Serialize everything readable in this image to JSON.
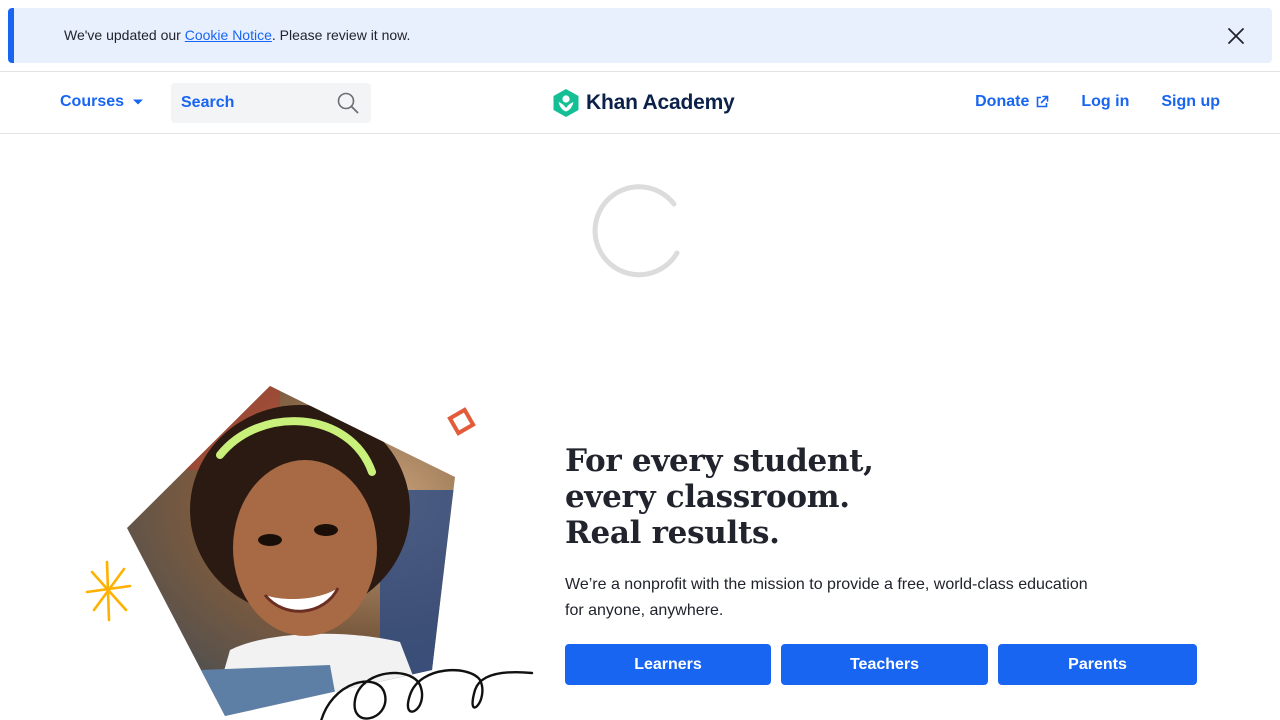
{
  "cookie_banner": {
    "prefix": "We've updated our ",
    "link_text": "Cookie Notice",
    "suffix": ". Please review it now."
  },
  "header": {
    "courses_label": "Courses",
    "search_label": "Search",
    "logo_text": "Khan Academy",
    "donate_label": "Donate",
    "login_label": "Log in",
    "signup_label": "Sign up"
  },
  "hero": {
    "headline_line1": "For every student,",
    "headline_line2": "every classroom.",
    "headline_line3": "Real results.",
    "mission": "We’re a nonprofit with the mission to provide a free, world-class education for anyone, anywhere.",
    "buttons": [
      {
        "label": "Learners"
      },
      {
        "label": "Teachers"
      },
      {
        "label": "Parents"
      }
    ]
  },
  "colors": {
    "accent": "#1865f2",
    "banner_bg": "#e9f0fd",
    "logo_green": "#14bf96",
    "logo_navy": "#0b2149",
    "doodle_yellow": "#ffb100",
    "doodle_orange": "#e35c3a"
  },
  "icons": {
    "close": "close-icon",
    "courses_caret": "caret-down-icon",
    "search": "search-icon",
    "logo": "khan-hexagon-logo",
    "donate_external": "external-link-icon"
  }
}
